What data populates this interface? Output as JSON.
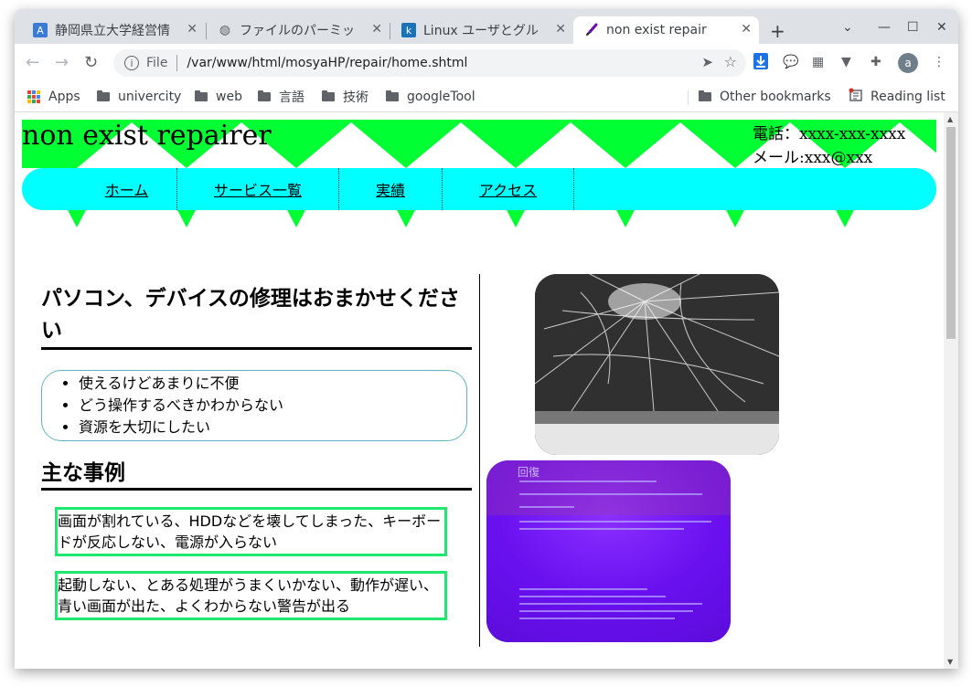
{
  "tabs": [
    {
      "title": "静岡県立大学経営情",
      "favicon": "A"
    },
    {
      "title": "ファイルのパーミッ",
      "favicon": "globe"
    },
    {
      "title": "Linux ユーザとグル",
      "favicon": "k"
    },
    {
      "title": "non exist repair",
      "favicon": "brush"
    }
  ],
  "toolbar": {
    "scheme": "File",
    "url": "/var/www/html/mosyaHP/repair/home.shtml",
    "avatar": "a"
  },
  "bookmarks": {
    "apps": "Apps",
    "items": [
      "univercity",
      "web",
      "言語",
      "技術",
      "googleTool"
    ],
    "other": "Other bookmarks",
    "reading_list": "Reading list"
  },
  "page": {
    "site_title": "non exist repairer",
    "contact": {
      "phone": "電話：xxxx-xxx-xxxx",
      "email": "メール:xxx@xxx"
    },
    "nav": [
      "ホーム",
      "サービス一覧",
      "実績",
      "アクセス"
    ],
    "main_heading": "パソコン、デバイスの修理はおまかせください",
    "reasons": [
      "使えるけどあまりに不便",
      "どう操作するべきかわからない",
      "資源を大切にしたい"
    ],
    "cases_heading": "主な事例",
    "cases": [
      "画面が割れている、HDDなどを壊してしまった、キーボードが反応しない、電源が入らない",
      "起動しない、とある処理がうまくいかない、動作が遅い、青い画面が出た、よくわからない警告が出る"
    ],
    "blue_screen_heading": "回復"
  },
  "colors": {
    "banner_green": "#00ff33",
    "nav_cyan": "#00ffff",
    "case_border": "#1ee870",
    "reasons_border": "#5fb6b6"
  }
}
